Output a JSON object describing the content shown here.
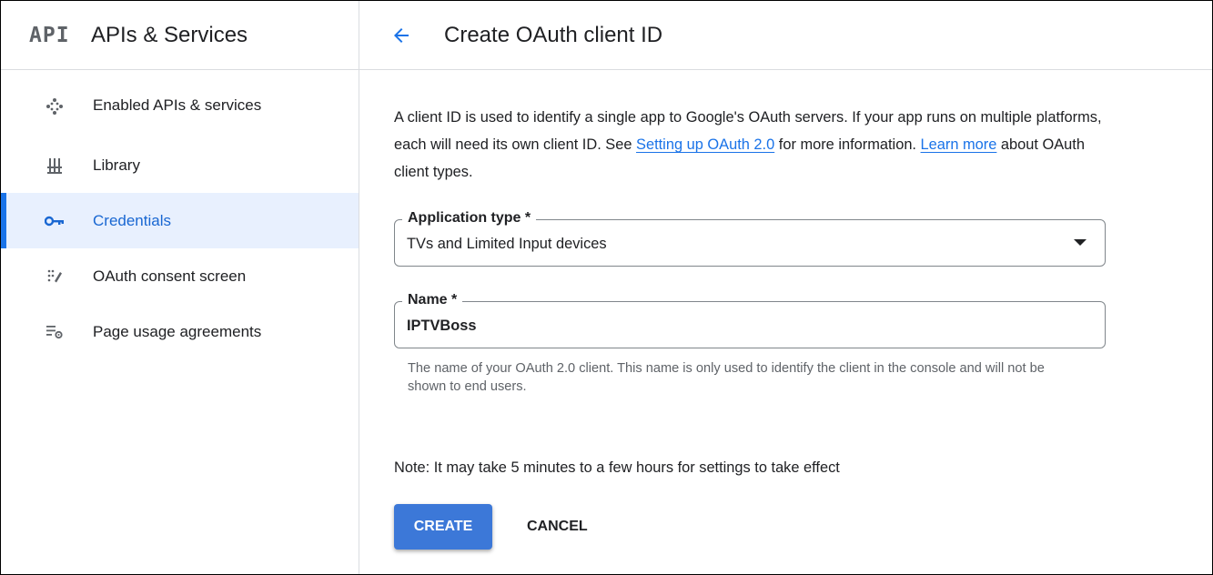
{
  "sidebar": {
    "logo_text": "API",
    "title": "APIs & Services",
    "items": [
      {
        "label": "Enabled APIs & services",
        "icon": "dots-diamond-icon"
      },
      {
        "label": "Library",
        "icon": "library-icon"
      },
      {
        "label": "Credentials",
        "icon": "key-icon",
        "active": true
      },
      {
        "label": "OAuth consent screen",
        "icon": "consent-icon"
      },
      {
        "label": "Page usage agreements",
        "icon": "settings-list-icon"
      }
    ]
  },
  "header": {
    "back_icon": "arrow-back-icon",
    "title": "Create OAuth client ID"
  },
  "intro": {
    "part1": "A client ID is used to identify a single app to Google's OAuth servers. If your app runs on multiple platforms, each will need its own client ID. See ",
    "link1": "Setting up OAuth 2.0",
    "part2": " for more information. ",
    "link2": "Learn more",
    "part3": " about OAuth client types."
  },
  "form": {
    "app_type": {
      "label": "Application type *",
      "value": "TVs and Limited Input devices"
    },
    "name": {
      "label": "Name *",
      "value": "IPTVBoss",
      "helper": "The name of your OAuth 2.0 client. This name is only used to identify the client in the console and will not be shown to end users."
    }
  },
  "note": "Note: It may take 5 minutes to a few hours for settings to take effect",
  "actions": {
    "create_label": "CREATE",
    "cancel_label": "CANCEL"
  },
  "colors": {
    "accent": "#1a73e8",
    "active_bg": "#e8f0fe",
    "create_button": "#3c78d8"
  }
}
